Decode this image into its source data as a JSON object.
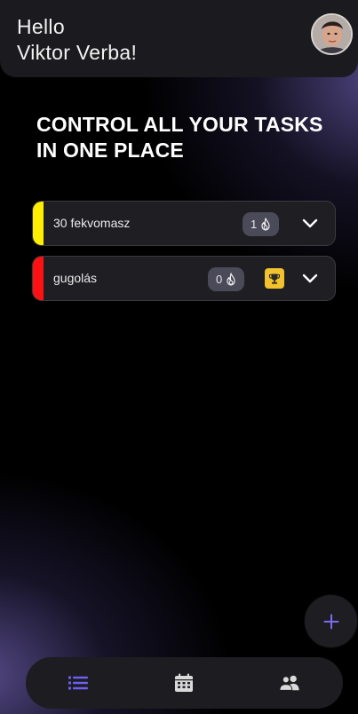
{
  "header": {
    "greeting_line1": "Hello",
    "greeting_line2": "Viktor Verba!",
    "avatar_icon": "user-avatar"
  },
  "headline": {
    "line1": "CONTROL ALL YOUR TASKS",
    "line2": "IN ONE PLACE"
  },
  "tasks": [
    {
      "name": "30 fekvomasz",
      "stripe_color": "#ffee00",
      "streak": "1",
      "streak_icon": "flame-icon",
      "has_trophy": false,
      "expand_icon": "chevron-down-icon"
    },
    {
      "name": "gugolás",
      "stripe_color": "#ff1111",
      "streak": "0",
      "streak_icon": "flame-icon",
      "has_trophy": true,
      "trophy_color": "#f2c12e",
      "expand_icon": "chevron-down-icon"
    }
  ],
  "fab": {
    "icon": "plus-icon",
    "color": "#7c6cf0"
  },
  "nav": {
    "items": [
      {
        "icon": "list-icon",
        "active": true,
        "color": "#6e5ff0"
      },
      {
        "icon": "calendar-icon",
        "active": false,
        "color": "#d9d9d9"
      },
      {
        "icon": "users-icon",
        "active": false,
        "color": "#d9d9d9"
      }
    ]
  }
}
